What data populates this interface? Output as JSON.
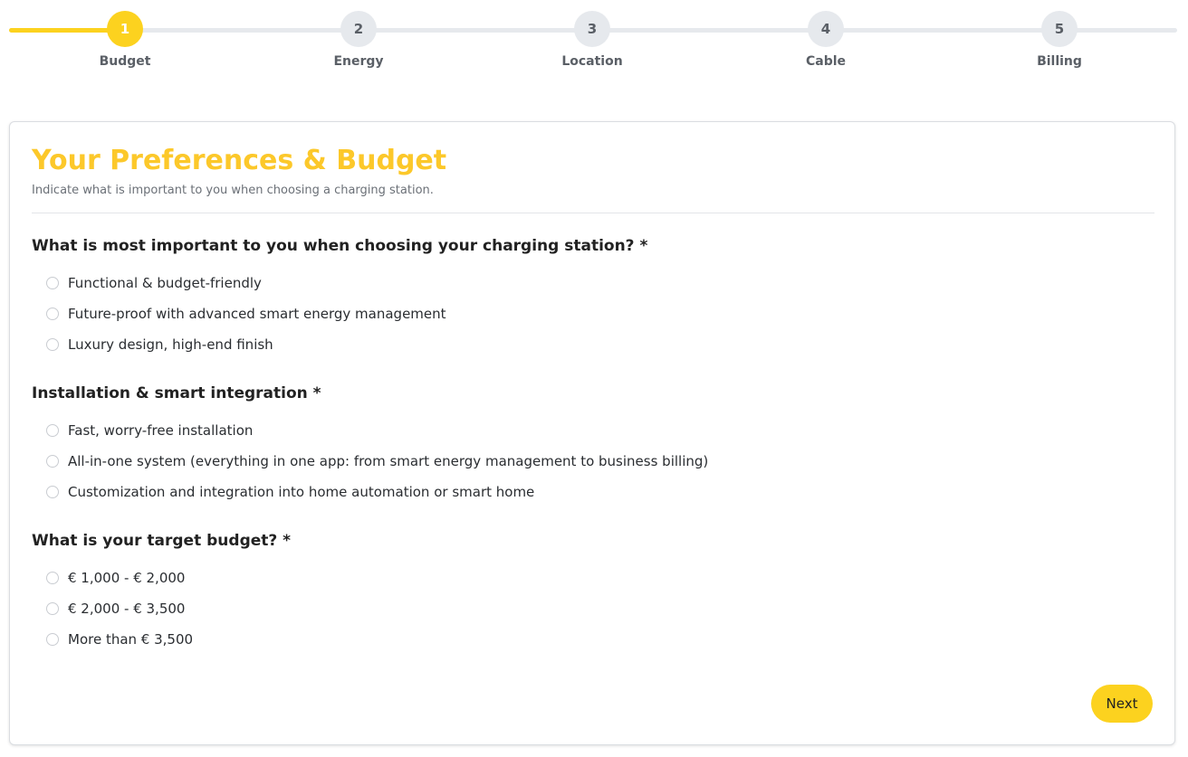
{
  "colors": {
    "accent": "#fcd21f",
    "title": "#fcc82a",
    "inactive_step": "#e6e9ed"
  },
  "stepper": {
    "progress_fraction": 0.1,
    "steps": [
      {
        "number": "1",
        "label": "Budget",
        "active": true
      },
      {
        "number": "2",
        "label": "Energy",
        "active": false
      },
      {
        "number": "3",
        "label": "Location",
        "active": false
      },
      {
        "number": "4",
        "label": "Cable",
        "active": false
      },
      {
        "number": "5",
        "label": "Billing",
        "active": false
      }
    ]
  },
  "form": {
    "title": "Your Preferences & Budget",
    "subtitle": "Indicate what is important to you when choosing a charging station.",
    "questions": [
      {
        "label": "What is most important to you when choosing your charging station? *",
        "options": [
          "Functional & budget-friendly",
          "Future-proof with advanced smart energy management",
          "Luxury design, high-end finish"
        ]
      },
      {
        "label": "Installation & smart integration *",
        "options": [
          "Fast, worry-free installation",
          "All-in-one system (everything in one app: from smart energy management to business billing)",
          "Customization and integration into home automation or smart home"
        ]
      },
      {
        "label": "What is your target budget? *",
        "options": [
          "€ 1,000 - € 2,000",
          "€ 2,000 - € 3,500",
          "More than € 3,500"
        ]
      }
    ],
    "next_label": "Next"
  }
}
